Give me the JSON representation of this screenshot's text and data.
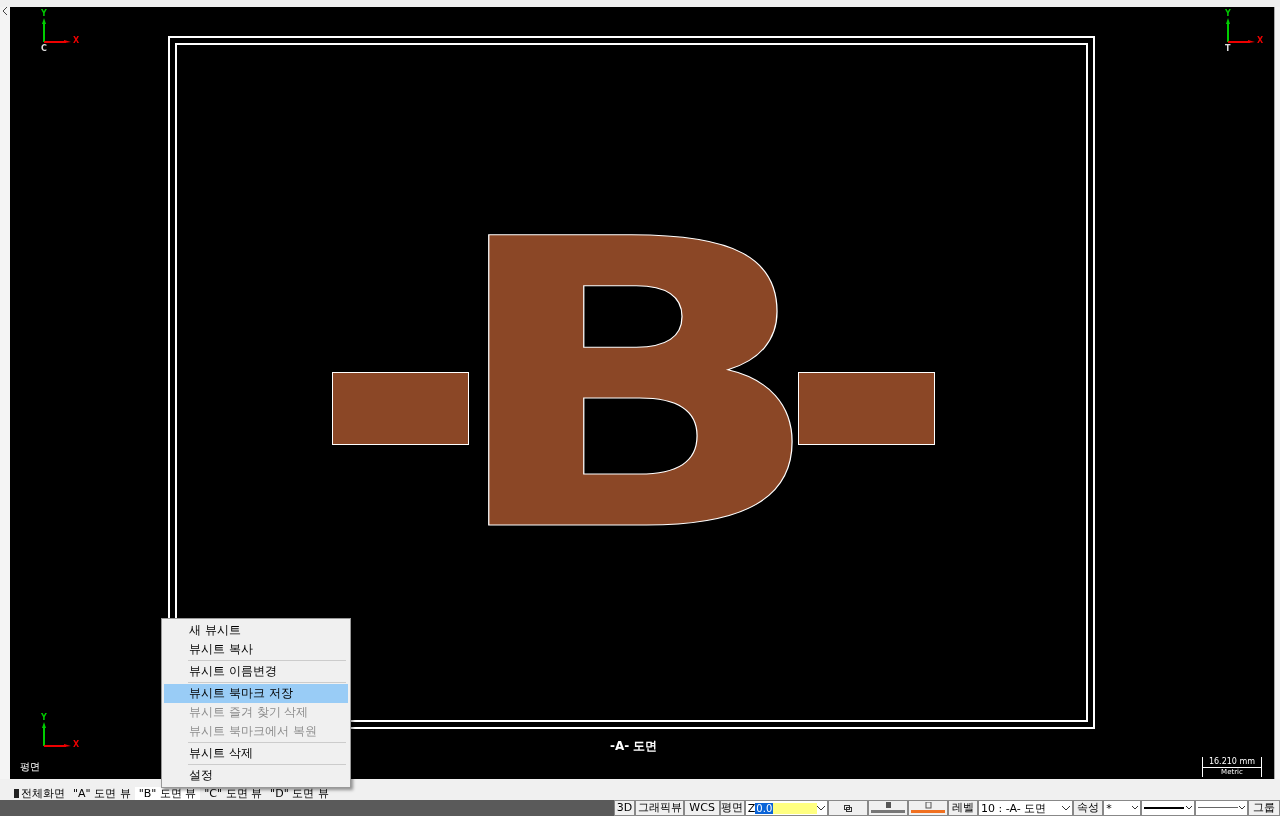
{
  "canvas": {
    "axes": [
      {
        "y": "Y",
        "x": "X",
        "origin": "C"
      },
      {
        "y": "Y",
        "x": "X",
        "origin": "T"
      },
      {
        "y": "Y",
        "x": "X"
      }
    ],
    "drawing_text": "B",
    "view_label": "-A- 도면",
    "view_name": "평면",
    "scale": {
      "value": "16.210 mm",
      "unit": "Metric"
    }
  },
  "context_menu": [
    {
      "label": "새 뷰시트",
      "disabled": false,
      "selected": false,
      "separator_before": false
    },
    {
      "label": "뷰시트 복사",
      "disabled": false,
      "selected": false,
      "separator_before": false
    },
    {
      "label": "뷰시트 이름변경",
      "disabled": false,
      "selected": false,
      "separator_before": true
    },
    {
      "label": "뷰시트 북마크 저장",
      "disabled": false,
      "selected": true,
      "separator_before": true
    },
    {
      "label": "뷰시트 즐겨 찾기 삭제",
      "disabled": true,
      "selected": false,
      "separator_before": false
    },
    {
      "label": "뷰시트 북마크에서 복원",
      "disabled": true,
      "selected": false,
      "separator_before": false
    },
    {
      "label": "뷰시트 삭제",
      "disabled": false,
      "selected": false,
      "separator_before": true
    },
    {
      "label": "설정",
      "disabled": false,
      "selected": false,
      "separator_before": true
    }
  ],
  "tabs": [
    {
      "label": "전체화면",
      "selected": false
    },
    {
      "label": "\"A\" 도면 뷰",
      "selected": false
    },
    {
      "label": "\"B\" 도면 뷰",
      "selected": true
    },
    {
      "label": "\"C\" 도면 뷰",
      "selected": false
    },
    {
      "label": "\"D\" 도면 뷰",
      "selected": false
    }
  ],
  "status_bar": {
    "buttons": [
      "3D",
      "그래픽뷰",
      "WCS",
      "평면"
    ],
    "z_label": "Z",
    "z_value": "0.0",
    "level_label": "레벨",
    "level_value": "10 : -A- 도면",
    "attr_label": "속성",
    "style_value": "*",
    "group_label": "그룹"
  }
}
